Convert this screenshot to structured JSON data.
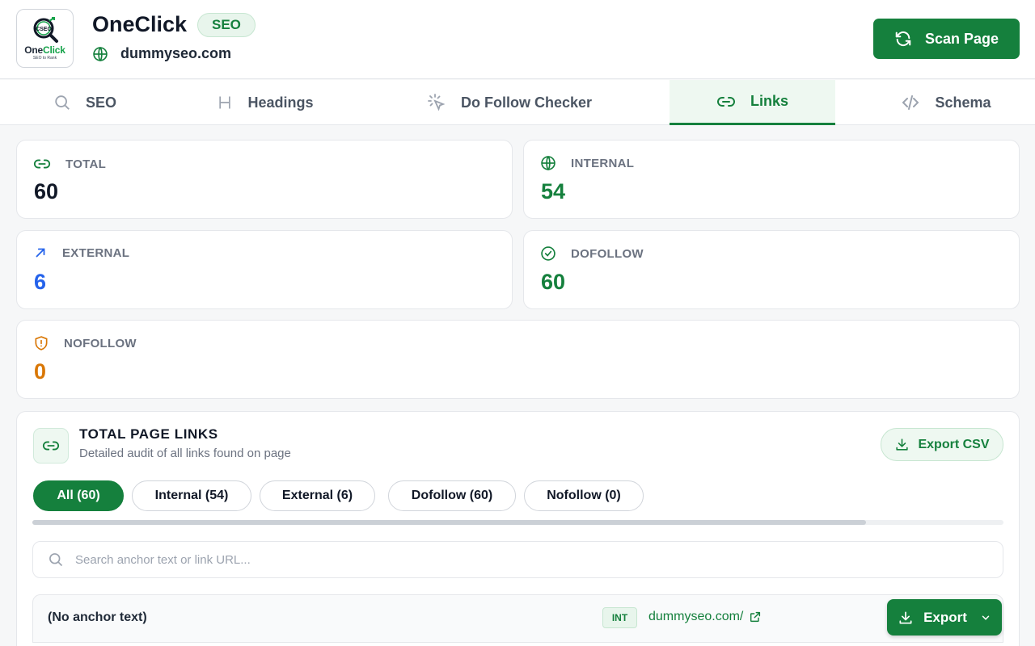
{
  "header": {
    "logo_word": "One",
    "logo_word_accent": "Click",
    "logo_tagline": "SEO to Rank",
    "logo_mark": "CSEO",
    "title": "OneClick",
    "badge": "SEO",
    "domain": "dummyseo.com",
    "scan_label": "Scan Page"
  },
  "tabs": [
    {
      "label": "SEO",
      "icon": "search-icon"
    },
    {
      "label": "Headings",
      "icon": "heading-icon"
    },
    {
      "label": "Do Follow Checker",
      "icon": "cursor-click-icon"
    },
    {
      "label": "Links",
      "icon": "link-icon",
      "active": true
    },
    {
      "label": "Schema",
      "icon": "code-icon"
    }
  ],
  "stats": {
    "total": {
      "label": "TOTAL",
      "value": "60",
      "icon": "link-icon"
    },
    "internal": {
      "label": "INTERNAL",
      "value": "54",
      "icon": "globe-icon"
    },
    "external": {
      "label": "EXTERNAL",
      "value": "6",
      "icon": "arrow-up-right-icon"
    },
    "dofollow": {
      "label": "DOFOLLOW",
      "value": "60",
      "icon": "check-circle-icon"
    },
    "nofollow": {
      "label": "NOFOLLOW",
      "value": "0",
      "icon": "shield-alert-icon"
    }
  },
  "links_section": {
    "title": "TOTAL PAGE LINKS",
    "subtitle": "Detailed audit of all links found on page",
    "export_csv_label": "Export CSV",
    "filters": [
      {
        "label": "All (60)",
        "active": true
      },
      {
        "label": "Internal (54)"
      },
      {
        "label": "External (6)"
      },
      {
        "label": "Dofollow (60)"
      },
      {
        "label": "Nofollow (0)"
      }
    ],
    "search_placeholder": "Search anchor text or link URL...",
    "rows": [
      {
        "anchor": "(No anchor text)",
        "type": "INT",
        "url": "dummyseo.com/"
      }
    ],
    "export_label": "Export"
  },
  "colors": {
    "accent": "#15803d",
    "external": "#2563eb",
    "nofollow": "#d97706"
  }
}
